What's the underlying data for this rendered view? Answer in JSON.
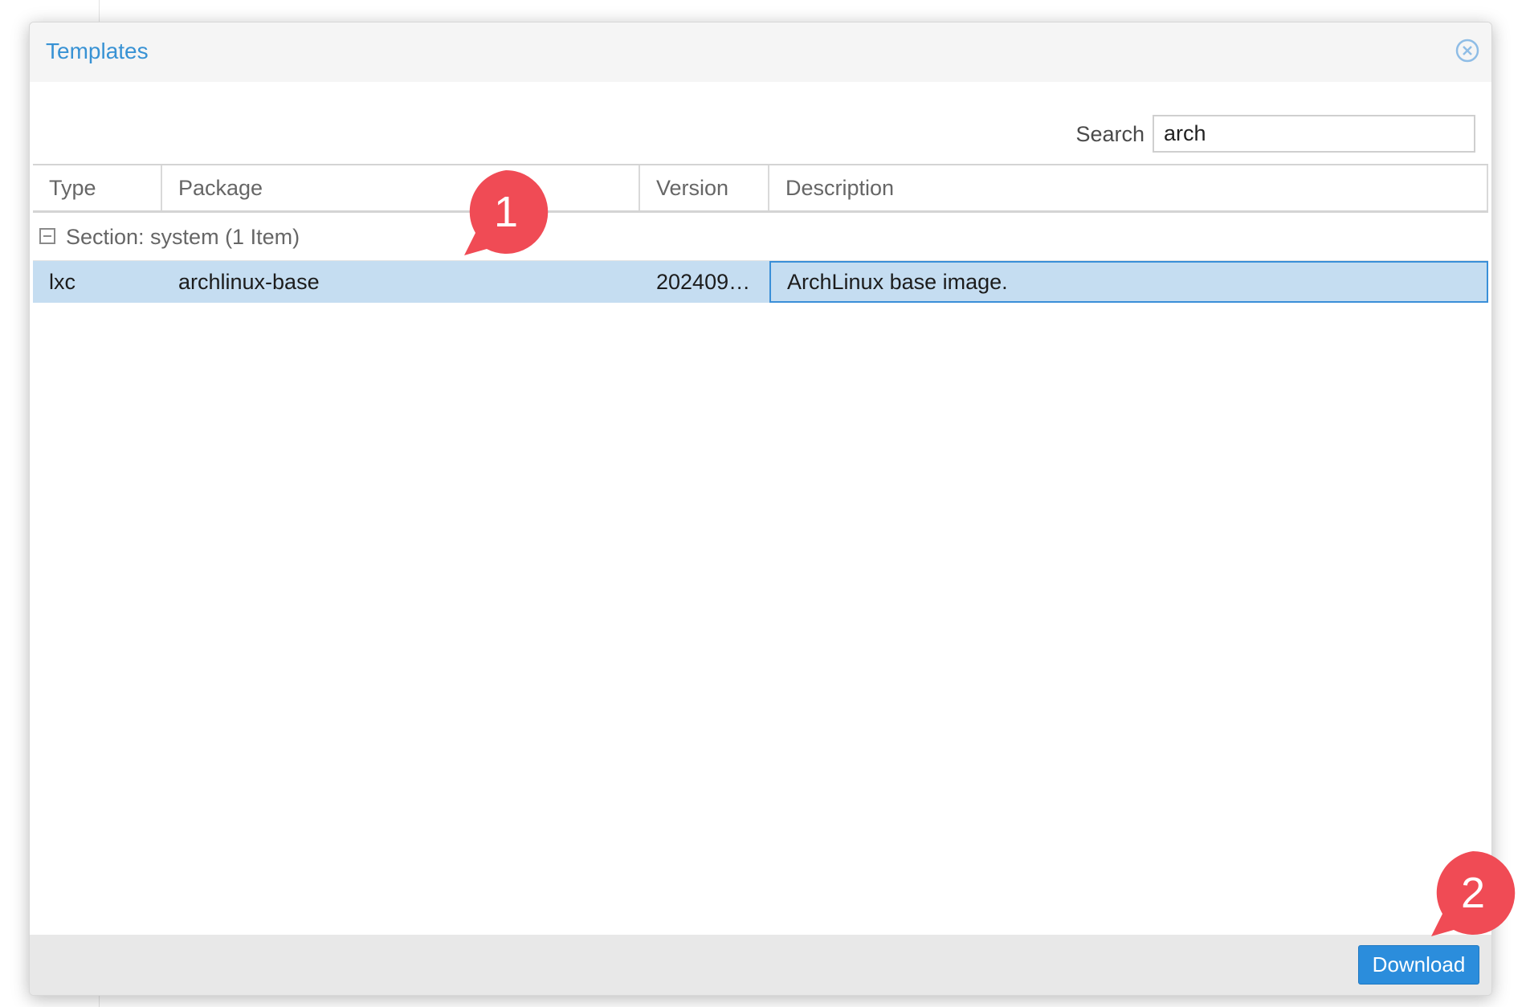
{
  "dialog": {
    "title": "Templates",
    "close_icon": "close-circle-icon"
  },
  "toolbar": {
    "search_label": "Search",
    "search_value": "arch"
  },
  "grid": {
    "columns": [
      "Type",
      "Package",
      "Version",
      "Description"
    ],
    "group": {
      "label": "Section: system (1 Item)",
      "collapse_icon": "collapse-minus-icon"
    },
    "rows": [
      {
        "type": "lxc",
        "package": "archlinux-base",
        "version": "202409…",
        "description": "ArchLinux base image.",
        "selected": true
      }
    ]
  },
  "footer": {
    "download_label": "Download"
  },
  "callouts": [
    {
      "label": "1"
    },
    {
      "label": "2"
    }
  ],
  "colors": {
    "accent": "#3892d4",
    "selected_row": "#c5ddf1",
    "button": "#2b8ddc",
    "callout": "#f04b55"
  }
}
